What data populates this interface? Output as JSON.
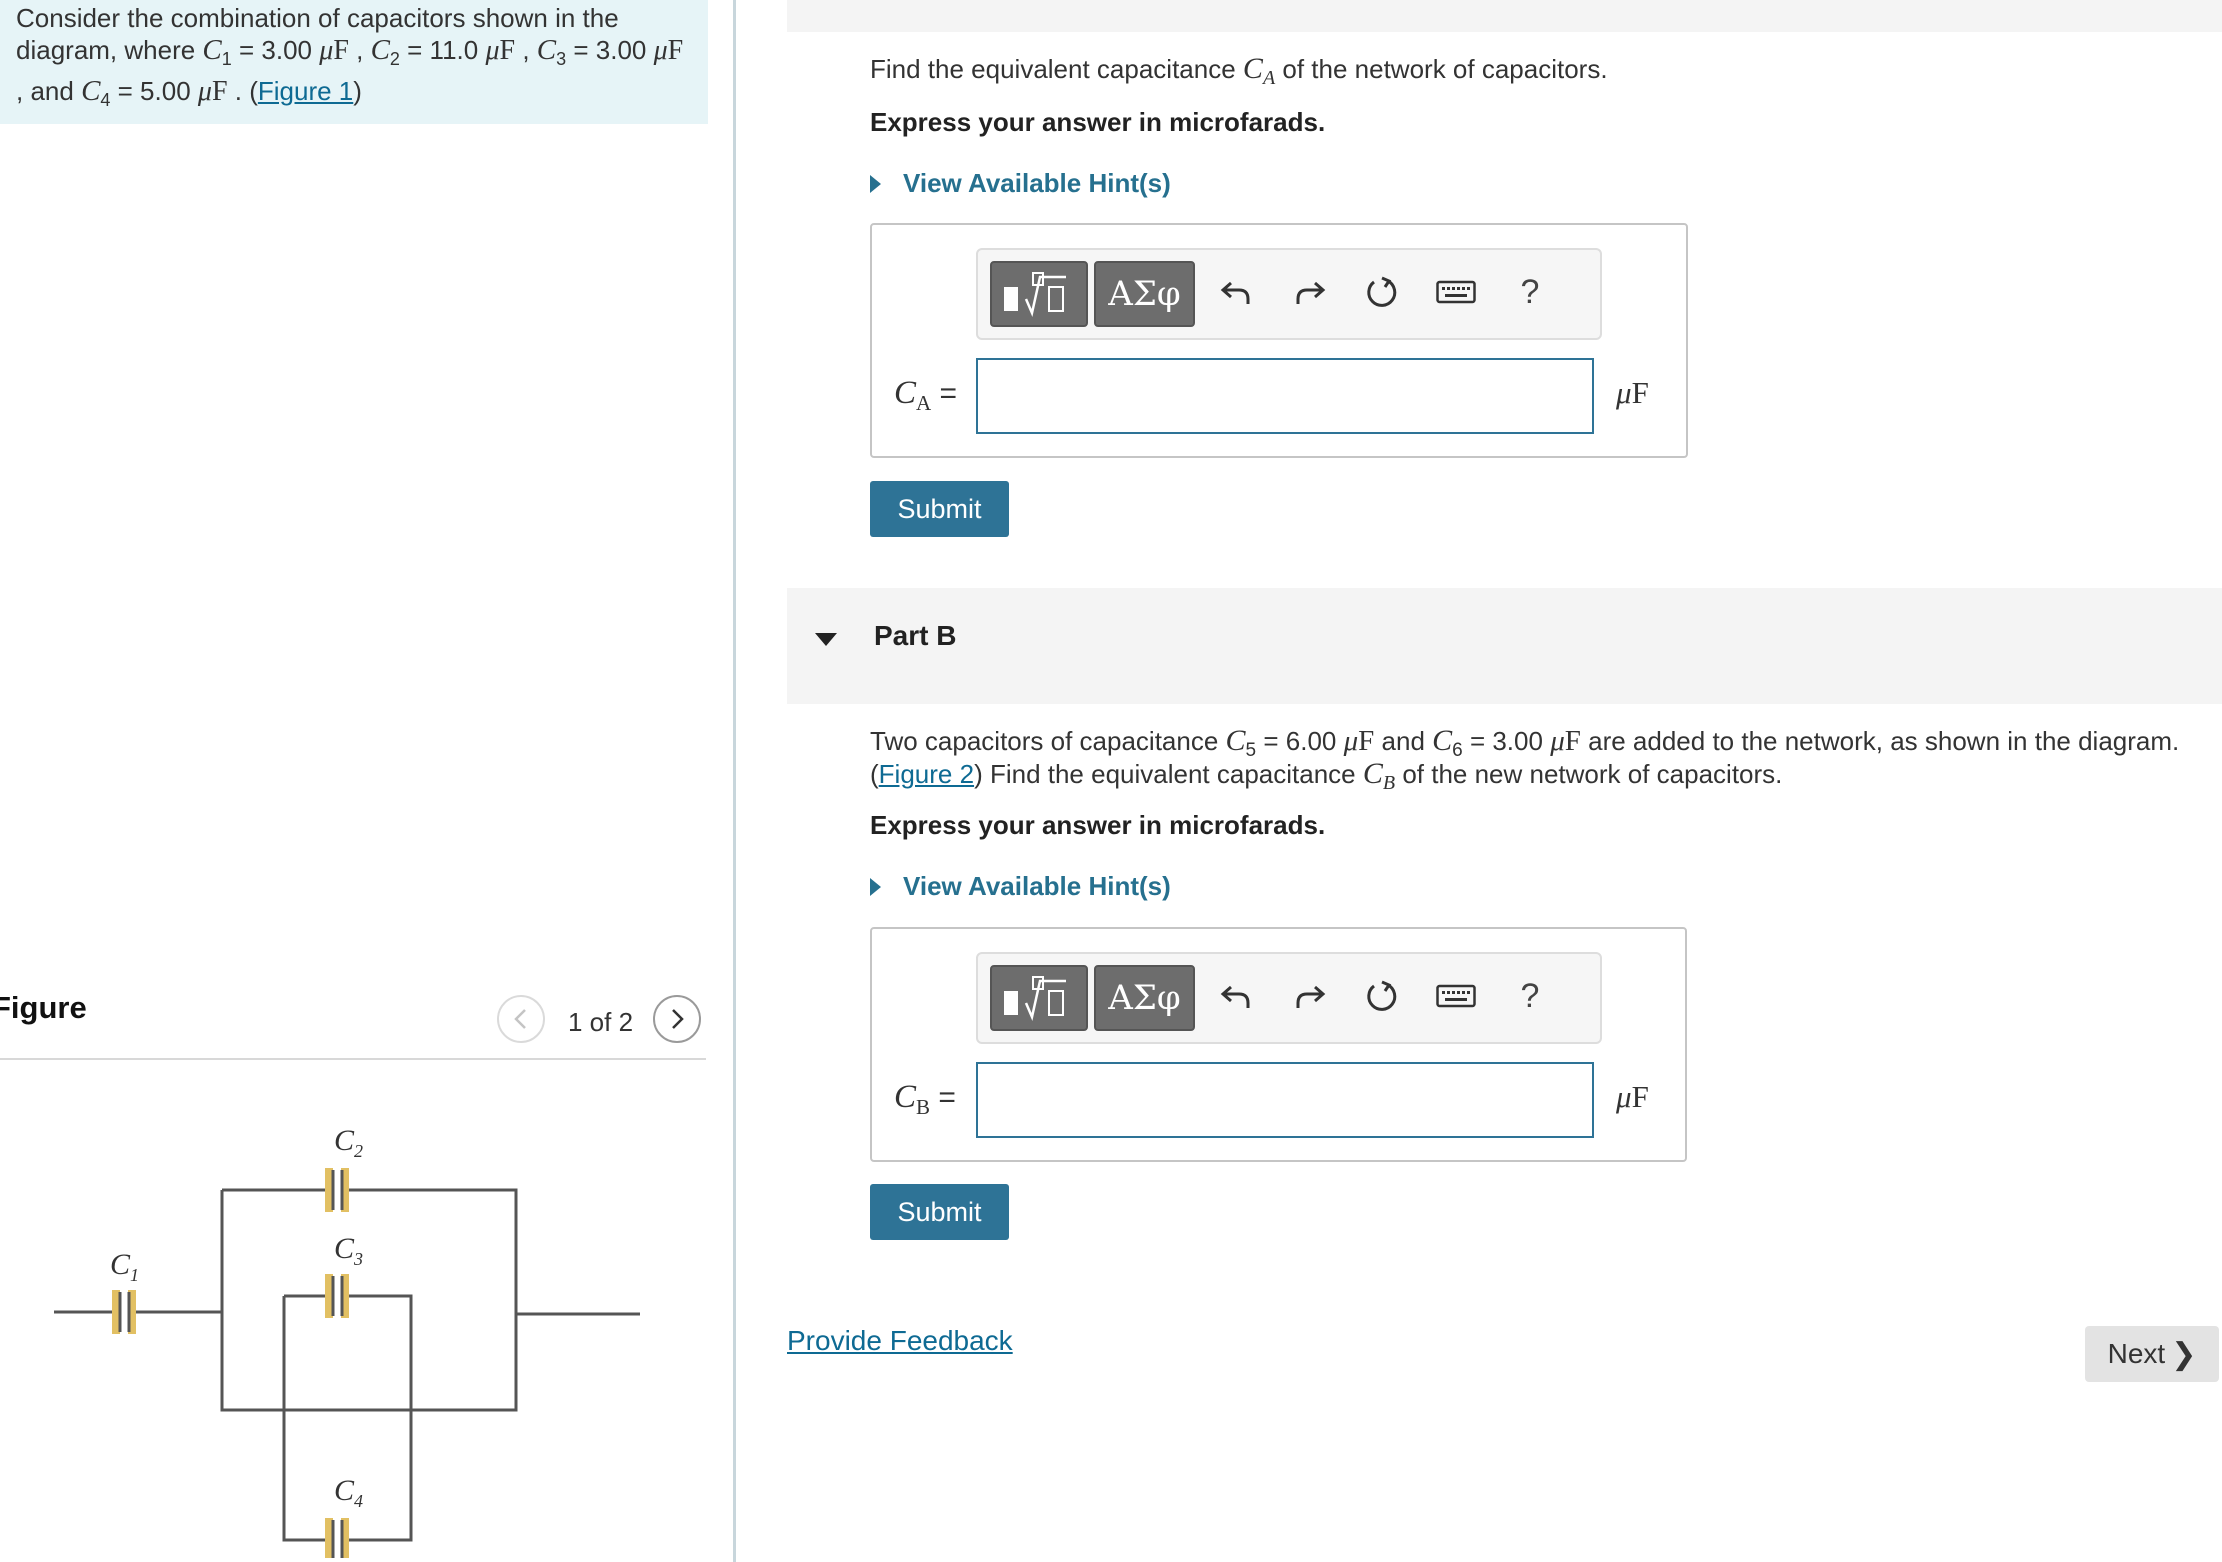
{
  "intro": {
    "t1": "Consider the combination of capacitors shown in the diagram, where ",
    "c1": "C",
    "c1_sub": "1",
    "eq1": " = 3.00 ",
    "mu": "μ",
    "F": "F",
    "sep1": " , ",
    "c2": "C",
    "c2_sub": "2",
    "eq2": " = 11.0 ",
    "sep2": " , ",
    "c3": "C",
    "c3_sub": "3",
    "eq3": " = 3.00 ",
    "sep3": " , and ",
    "c4": "C",
    "c4_sub": "4",
    "eq4": " = 5.00 ",
    "sep4": " . (",
    "figure_link": "Figure 1",
    "close": ")"
  },
  "figure": {
    "heading": "Figure",
    "counter": "1 of 2",
    "labels": {
      "c1": "C",
      "c1_sub": "1",
      "c2": "C",
      "c2_sub": "2",
      "c3": "C",
      "c3_sub": "3",
      "c4": "C",
      "c4_sub": "4"
    }
  },
  "part_a": {
    "q_pre": "Find the equivalent capacitance ",
    "q_var": "C",
    "q_sub": "A",
    "q_post": " of the network of capacitors.",
    "instruction": "Express your answer in microfarads.",
    "hint": "View Available Hint(s)",
    "greek_label": "ΑΣφ",
    "help": "?",
    "var_name": "C",
    "var_sub": "A",
    "equals": " =",
    "unit_mu": "μ",
    "unit_f": "F",
    "submit": "Submit"
  },
  "part_b": {
    "title": "Part B",
    "t1": "Two capacitors of capacitance ",
    "c5": "C",
    "c5_sub": "5",
    "eq5": " = 6.00 ",
    "mid": " and ",
    "c6": "C",
    "c6_sub": "6",
    "eq6": " = 3.00 ",
    "t2": " are added to the network, as shown in the diagram.",
    "open": "(",
    "figure_link": "Figure 2",
    "t3": ") Find the equivalent capacitance ",
    "cb": "C",
    "cb_sub": "B",
    "t4": " of the new network of capacitors.",
    "instruction": "Express your answer in microfarads.",
    "hint": "View Available Hint(s)",
    "greek_label": "ΑΣφ",
    "help": "?",
    "var_name": "C",
    "var_sub": "B",
    "equals": " =",
    "unit_mu": "μ",
    "unit_f": "F",
    "submit": "Submit"
  },
  "footer": {
    "feedback": "Provide Feedback",
    "next": "Next"
  },
  "colors": {
    "accent": "#2e7396",
    "link": "#0e6a93",
    "intro_bg": "#e6f4f7",
    "toolbar_btn": "#6d6d6d",
    "capacitor_plate": "#e2c063"
  }
}
